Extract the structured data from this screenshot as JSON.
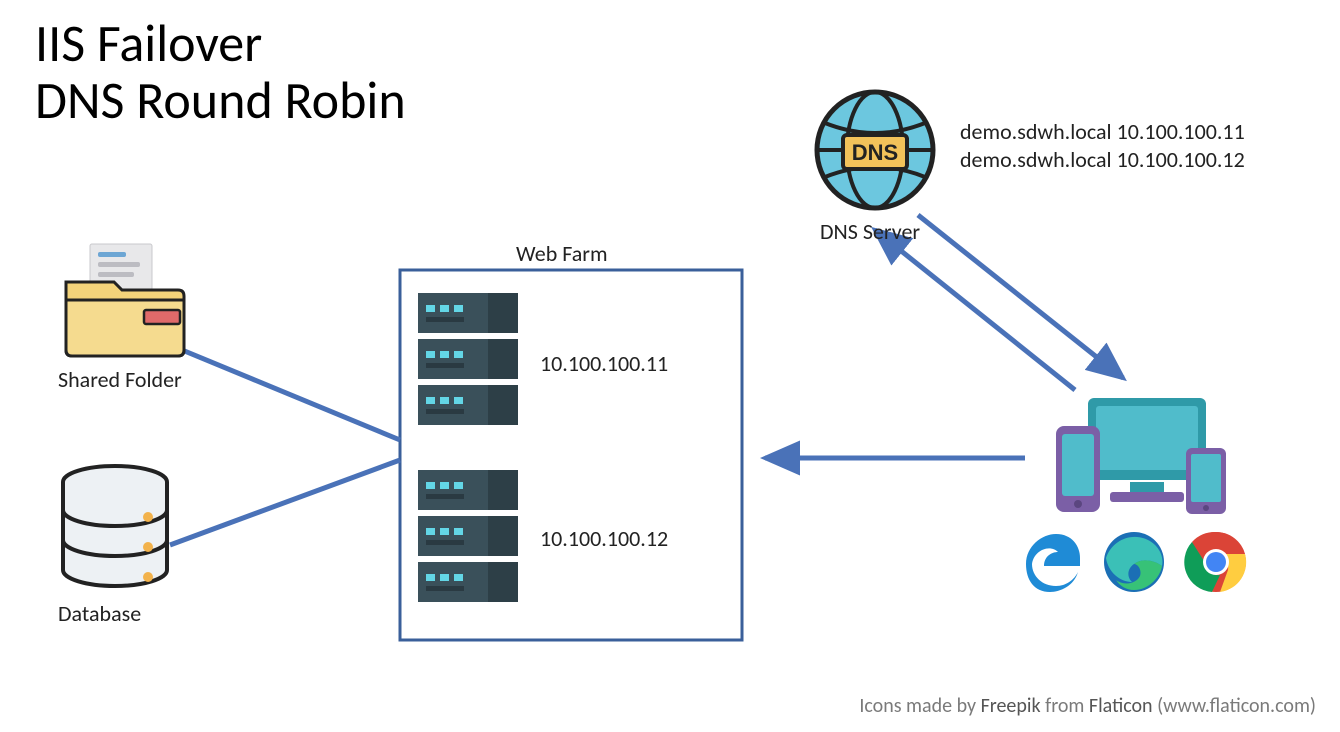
{
  "title_line1": "IIS Failover",
  "title_line2": "DNS Round Robin",
  "shared_folder_label": "Shared Folder",
  "database_label": "Database",
  "webfarm_label": "Web Farm",
  "server1_ip": "10.100.100.11",
  "server2_ip": "10.100.100.12",
  "dns_server_label": "DNS Server",
  "dns_record_1": "demo.sdwh.local 10.100.100.11",
  "dns_record_2": "demo.sdwh.local 10.100.100.12",
  "attribution_prefix": "Icons made by ",
  "attribution_author": "Freepik",
  "attribution_mid": " from ",
  "attribution_source": "Flaticon",
  "attribution_suffix": " (www.flaticon.com)",
  "colors": {
    "line": "#4a72b8",
    "box": "#3a5f9a"
  }
}
